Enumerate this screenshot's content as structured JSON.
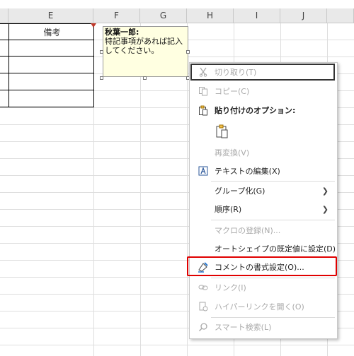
{
  "columns": [
    {
      "label": "E"
    },
    {
      "label": "F"
    },
    {
      "label": "G"
    },
    {
      "label": "H"
    },
    {
      "label": "I"
    },
    {
      "label": "J"
    }
  ],
  "table": {
    "header": "備考"
  },
  "comment": {
    "author": "秋葉一郎:",
    "line1": "特記事項があれば記入",
    "line2": "してください。"
  },
  "menu": {
    "cut": "切り取り(T)",
    "copy": "コピー(C)",
    "paste_options": "貼り付けのオプション:",
    "reconvert": "再変換(V)",
    "edit_text": "テキストの編集(X)",
    "group": "グループ化(G)",
    "order": "順序(R)",
    "assign_macro": "マクロの登録(N)...",
    "set_default_shape": "オートシェイプの既定値に設定(D)",
    "format_comment": "コメントの書式設定(O)...",
    "link": "リンク(I)",
    "open_hyperlink": "ハイパーリンクを開く(O)",
    "smart_lookup": "スマート検索(L)"
  },
  "colors": {
    "highlight": "#e00000",
    "comment_bg": "#ffffe1"
  }
}
